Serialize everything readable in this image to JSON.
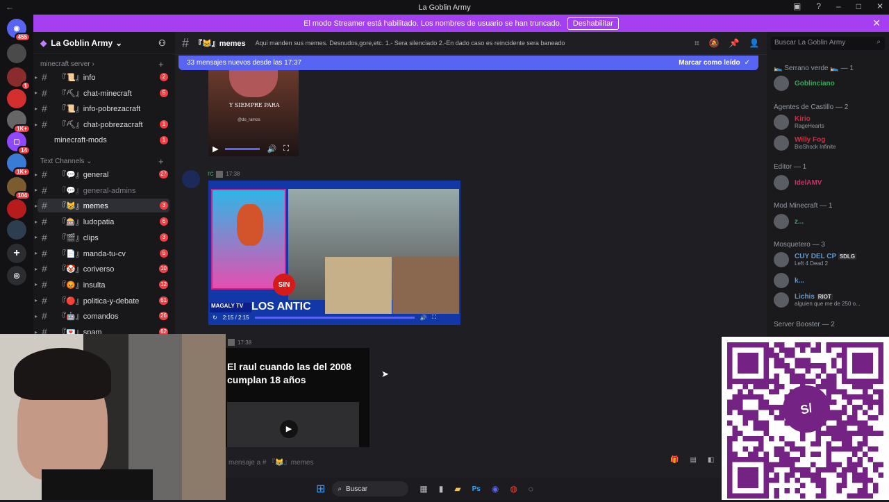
{
  "window": {
    "title": "La Goblin Army"
  },
  "rail": {
    "badges": [
      "455",
      "1",
      "1K+",
      "14",
      "1K+",
      "104"
    ]
  },
  "banner": {
    "text": "El modo Streamer está habilitado. Los nombres de usuario se han truncado.",
    "button": "Deshabilitar"
  },
  "guild": {
    "name": "La Goblin Army"
  },
  "categories": {
    "minecraft": "minecraft server",
    "text": "Text Channels"
  },
  "channels_minecraft": [
    {
      "name": "『📜』info",
      "badge": "2"
    },
    {
      "name": "『⛏』chat-minecraft",
      "badge": "5"
    },
    {
      "name": "『📜』info-pobrezacraft",
      "badge": ""
    },
    {
      "name": "『⛏』chat-pobrezacraft",
      "badge": "1"
    }
  ],
  "channel_extra": {
    "name": "minecraft-mods",
    "badge": "1"
  },
  "channels_text": [
    {
      "name": "『💬』general",
      "badge": "27"
    },
    {
      "name": "『💬』general-admins",
      "badge": ""
    },
    {
      "name": "『😹』memes",
      "badge": "3"
    },
    {
      "name": "『🎰』ludopatia",
      "badge": "6"
    },
    {
      "name": "『🎬』clips",
      "badge": "3"
    },
    {
      "name": "『📄』manda-tu-cv",
      "badge": "5"
    },
    {
      "name": "『🤡』coriverso",
      "badge": "10"
    },
    {
      "name": "『😡』insulta",
      "badge": "12"
    },
    {
      "name": "『🔴』politica-y-debate",
      "badge": "61"
    },
    {
      "name": "『🤖』comandos",
      "badge": "26"
    },
    {
      "name": "『💌』spam",
      "badge": "62"
    }
  ],
  "header": {
    "channel": "『😹』memes",
    "topic": "Aqui manden sus memes. Desnudos,gore,etc. 1.- Sera silenciado 2.-En dado caso es reincidente sera baneado",
    "search_placeholder": "Buscar La Goblin Army"
  },
  "newbar": {
    "text": "33 mensajes nuevos desde las 17:37",
    "mark": "Marcar como leído"
  },
  "messages": {
    "msg1": {
      "user": "rc",
      "time": "17:38",
      "video_time": "2:15 / 2:15"
    },
    "msg2": {
      "time": "17:38",
      "caption": "El  raul  cuando las del 2008 cumplan 18 años"
    }
  },
  "video1": {
    "overlay1": "Y SIEMPRE PARA",
    "overlay2": "@do_ramos"
  },
  "video2": {
    "logo": "SIN",
    "brand": "MAGALY TV",
    "headline": "LOS ANTIC"
  },
  "input": {
    "placeholder": "mensaje a # 『😹』memes"
  },
  "members": {
    "groups": [
      {
        "label": "🛌 Serrano verde 🛌 — 1"
      },
      {
        "label": "Agentes de Castillo — 2"
      },
      {
        "label": "Editor — 1"
      },
      {
        "label": "Mod Minecraft — 1"
      },
      {
        "label": "Mosquetero — 3"
      },
      {
        "label": "Server Booster — 2"
      }
    ],
    "list": [
      {
        "name": "Goblinciano",
        "sub": "",
        "color": "#3ba55c"
      },
      {
        "name": "Kirio",
        "sub": "RageHearts",
        "color": "#e8223b"
      },
      {
        "name": "Willy Fog",
        "sub": "BioShock Infinite",
        "color": "#e8223b"
      },
      {
        "name": "IdelAMV",
        "sub": "",
        "color": "#e91e63"
      },
      {
        "name": "z...",
        "sub": "",
        "color": "#3ba55c"
      },
      {
        "name": "CUY DEL CP",
        "tag": "SDLG",
        "sub": "Left 4 Dead 2",
        "color": "#5b9bd5"
      },
      {
        "name": "k...",
        "sub": "",
        "color": "#5b9bd5"
      },
      {
        "name": "Lichis",
        "tag": "RIOT",
        "sub": "alguien que me de 250 o...",
        "color": "#5b9bd5"
      }
    ]
  },
  "taskbar": {
    "search": "Buscar"
  }
}
